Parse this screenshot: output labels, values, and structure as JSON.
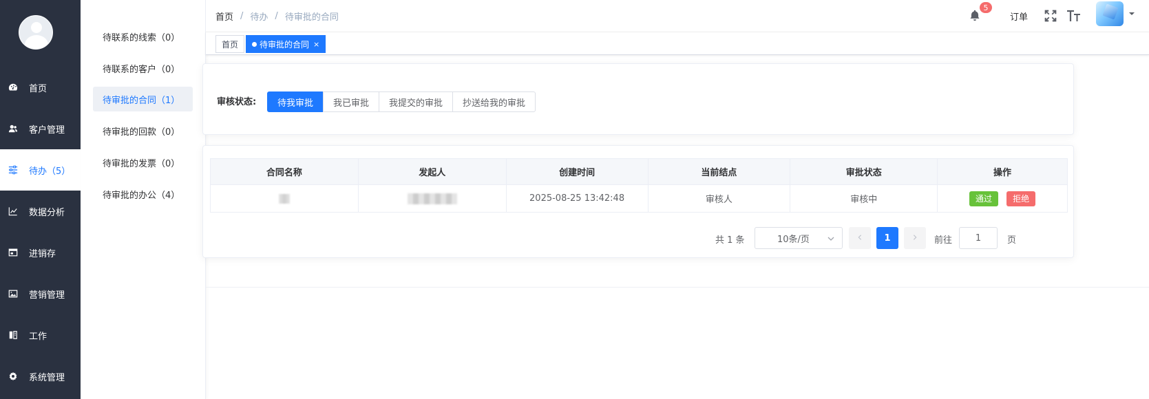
{
  "sidebar": {
    "items": [
      {
        "label": "首页",
        "icon": "dashboard-icon"
      },
      {
        "label": "客户管理",
        "icon": "users-icon"
      },
      {
        "label": "待办（5）",
        "icon": "sliders-icon",
        "active": true
      },
      {
        "label": "数据分析",
        "icon": "chart-line-icon"
      },
      {
        "label": "进销存",
        "icon": "window-icon"
      },
      {
        "label": "营销管理",
        "icon": "image-icon"
      },
      {
        "label": "工作",
        "icon": "book-icon"
      },
      {
        "label": "系统管理",
        "icon": "gear-icon"
      }
    ]
  },
  "subnav": {
    "items": [
      {
        "label": "待联系的线索（0）"
      },
      {
        "label": "待联系的客户（0）"
      },
      {
        "label": "待审批的合同（1）",
        "active": true
      },
      {
        "label": "待审批的回款（0）"
      },
      {
        "label": "待审批的发票（0）"
      },
      {
        "label": "待审批的办公（4）"
      }
    ]
  },
  "header": {
    "breadcrumb": [
      "首页",
      "待办",
      "待审批的合同"
    ],
    "separator": "/",
    "notification_count": "5",
    "order_label": "订单"
  },
  "tags": {
    "home": "首页",
    "active": "待审批的合同",
    "close": "×"
  },
  "filter": {
    "label": "审核状态:",
    "options": [
      "待我审批",
      "我已审批",
      "我提交的审批",
      "抄送给我的审批"
    ],
    "selected": "待我审批"
  },
  "table": {
    "columns": [
      "合同名称",
      "发起人",
      "创建时间",
      "当前结点",
      "审批状态",
      "操作"
    ],
    "rows": [
      {
        "created_at": "2025-08-25 13:42:48",
        "node": "审核人",
        "status": "审核中",
        "pass_label": "通过",
        "reject_label": "拒绝"
      }
    ]
  },
  "pagination": {
    "total": "共 1 条",
    "page_size": "10条/页",
    "current_page": "1",
    "goto_label": "前往",
    "goto_value": "1",
    "page_unit": "页"
  },
  "colors": {
    "sidebar_bg": "#2a3140",
    "accent": "#1e79ff",
    "success": "#67c23a",
    "danger": "#f56c6c"
  }
}
